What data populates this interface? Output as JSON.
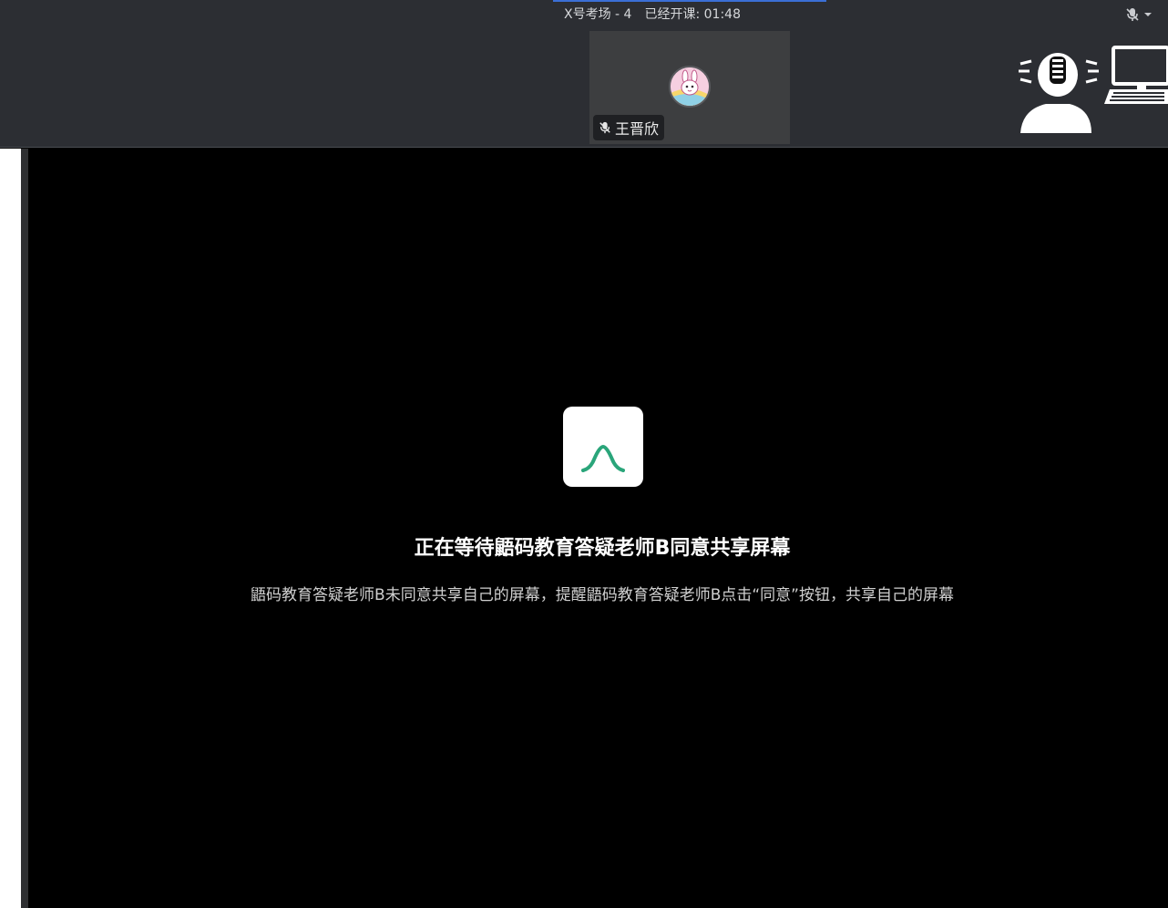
{
  "header": {
    "room_name": "X号考场 - 4",
    "elapsed_label": "已经开课: 01:48",
    "mic_state": "muted",
    "accent_color": "#3b6fd6"
  },
  "participant": {
    "name": "王晋欣",
    "mic_icon": "mic-muted-icon",
    "avatar_icon": "bunny-avatar"
  },
  "presenter_graphic": {
    "icon": "presenter-computer-icon"
  },
  "share_wait": {
    "icon": "app-logo-icon",
    "icon_color": "#2aa57a",
    "title": "正在等待鼯码教育答疑老师B同意共享屏幕",
    "description": "鼯码教育答疑老师B未同意共享自己的屏幕，提醒鼯码教育答疑老师B点击“同意”按钮，共享自己的屏幕"
  }
}
